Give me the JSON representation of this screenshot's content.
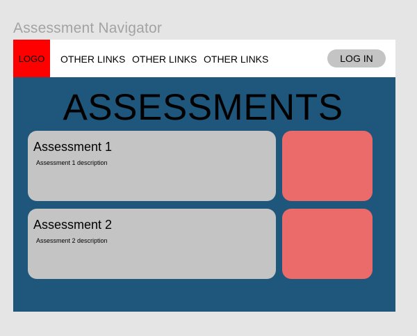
{
  "frame": {
    "title": "Assessment Navigator"
  },
  "navbar": {
    "logo": "LOGO",
    "links": [
      "OTHER LINKS",
      "OTHER LINKS",
      "OTHER LINKS"
    ],
    "login": "LOG IN"
  },
  "main": {
    "title": "ASSESSMENTS",
    "assessments": [
      {
        "title": "Assessment 1",
        "description": "Assessment 1 description"
      },
      {
        "title": "Assessment 2",
        "description": "Assessment 2 description"
      }
    ]
  },
  "colors": {
    "background": "#e5e5e5",
    "content_background": "#1f567c",
    "logo": "#ff0000",
    "card": "#c4c4c4",
    "card_side": "#eb6b6b"
  }
}
